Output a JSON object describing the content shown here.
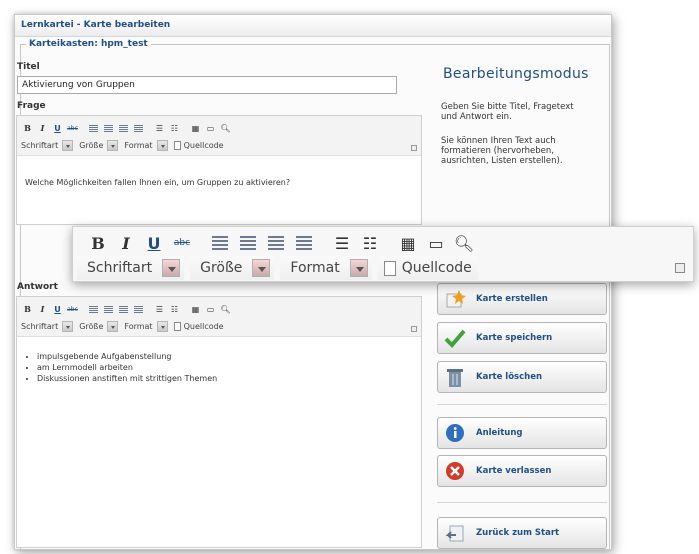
{
  "window": {
    "title": "Lernkartei - Karte bearbeiten"
  },
  "karteikasten": {
    "legend": "Karteikasten: hpm_test"
  },
  "titel": {
    "label": "Titel",
    "value": "Aktivierung von Gruppen"
  },
  "frage": {
    "label": "Frage",
    "content": "Welche Möglichkeiten fallen Ihnen ein, um Gruppen zu aktivieren?"
  },
  "antwort": {
    "label": "Antwort",
    "items": [
      "impulsgebende Aufgabenstellung",
      "am Lernmodell arbeiten",
      "Diskussionen anstiften mit strittigen Themen"
    ]
  },
  "toolbar": {
    "bold": "B",
    "italic": "I",
    "underline": "U",
    "strike": "abc",
    "font_label": "Schriftart",
    "size_label": "Größe",
    "format_label": "Format",
    "source_label": "Quellcode"
  },
  "sidebar": {
    "mode_title": "Bearbeitungsmodus",
    "help1": "Geben Sie bitte Titel, Fragetext und Antwort ein.",
    "help2": "Sie können Ihren Text auch formatieren (hervorheben, ausrichten, Listen erstellen).",
    "buttons": {
      "create": "Karte erstellen",
      "save": "Karte speichern",
      "delete": "Karte löschen",
      "guide": "Anleitung",
      "leave": "Karte verlassen",
      "back": "Zurück zum Start"
    }
  },
  "colors": {
    "accent": "#1f4f86",
    "border": "#c6c6c6"
  }
}
